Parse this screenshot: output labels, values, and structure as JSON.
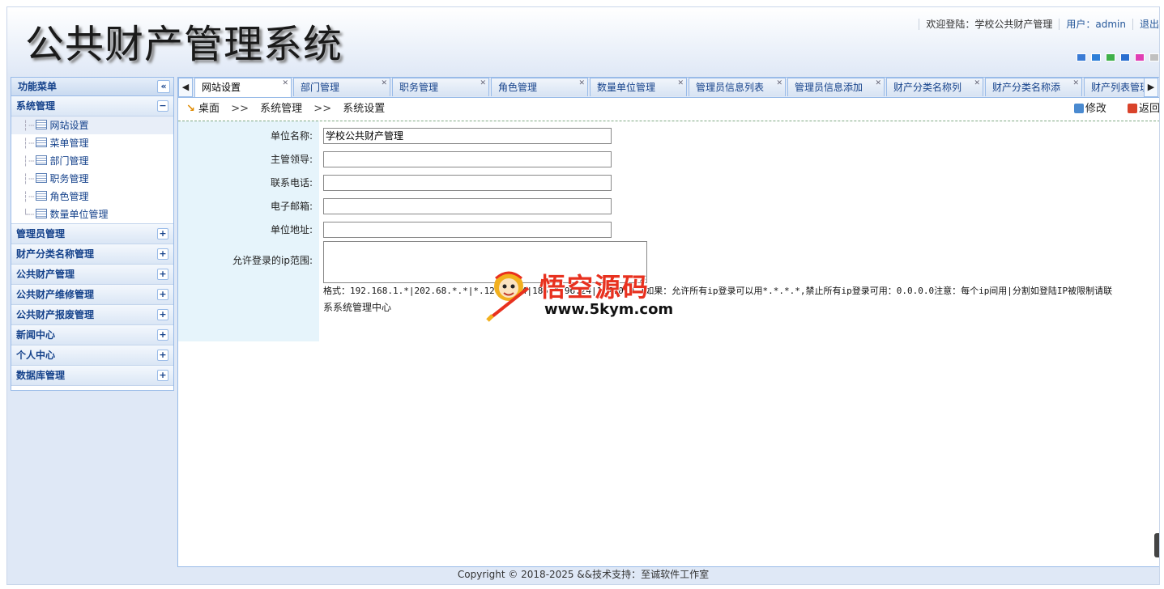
{
  "header": {
    "title": "公共财产管理系统",
    "welcome": "欢迎登陆：学校公共财产管理",
    "user": "用户：admin",
    "logout": "退出"
  },
  "theme_colors": [
    "#3a7bd5",
    "#2e7fd8",
    "#3fb04a",
    "#2a6fd0",
    "#e03fb4",
    "#c0c0c0"
  ],
  "sidebar": {
    "title": "功能菜单",
    "collapse_icon": "double-chevron-left-icon",
    "groups": [
      {
        "label": "系统管理",
        "expanded": true,
        "items": [
          {
            "label": "网站设置",
            "active": true
          },
          {
            "label": "菜单管理"
          },
          {
            "label": "部门管理"
          },
          {
            "label": "职务管理"
          },
          {
            "label": "角色管理"
          },
          {
            "label": "数量单位管理"
          }
        ]
      },
      {
        "label": "管理员管理"
      },
      {
        "label": "财产分类名称管理"
      },
      {
        "label": "公共财产管理"
      },
      {
        "label": "公共财产维修管理"
      },
      {
        "label": "公共财产报废管理"
      },
      {
        "label": "新闻中心"
      },
      {
        "label": "个人中心"
      },
      {
        "label": "数据库管理"
      }
    ]
  },
  "tabs": [
    {
      "label": "网站设置",
      "active": true
    },
    {
      "label": "部门管理"
    },
    {
      "label": "职务管理"
    },
    {
      "label": "角色管理"
    },
    {
      "label": "数量单位管理"
    },
    {
      "label": "管理员信息列表"
    },
    {
      "label": "管理员信息添加"
    },
    {
      "label": "财产分类名称列"
    },
    {
      "label": "财产分类名称添"
    },
    {
      "label": "财产列表管理"
    }
  ],
  "breadcrumb": {
    "home": "桌面",
    "sep": ">>",
    "level1": "系统管理",
    "level2": "系统设置"
  },
  "actions": {
    "edit": "修改",
    "back": "返回"
  },
  "form": {
    "unit_name_label": "单位名称:",
    "unit_name_value": "学校公共财产管理",
    "leader_label": "主管领导:",
    "leader_value": "",
    "phone_label": "联系电话:",
    "phone_value": "",
    "email_label": "电子邮箱:",
    "email_value": "",
    "address_label": "单位地址:",
    "address_value": "",
    "ip_label": "允许登录的ip范围:",
    "ip_value": "",
    "hint": "格式：192.168.1.*|202.68.*.*|*.12.55.34|185.*.96.24|127.0.0.1如果：允许所有ip登录可以用*.*.*.*,禁止所有ip登录可用：0.0.0.0注意：每个ip间用|分割如登陆IP被限制请联",
    "hint2": "系系统管理中心"
  },
  "watermark": {
    "text": "悟空源码",
    "url": "www.5kym.com"
  },
  "footer": {
    "copyright": "Copyright © 2018-2025 &&技术支持：至诚软件工作室"
  }
}
